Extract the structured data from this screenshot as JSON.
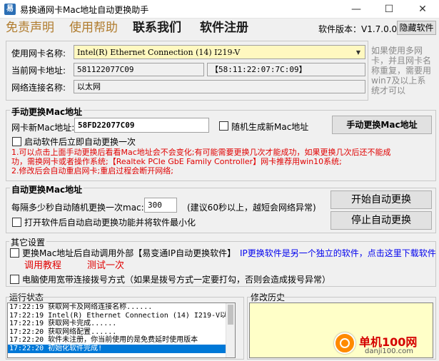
{
  "window": {
    "title": "易换通网卡Mac地址自动更换助手",
    "icon_text": "易",
    "minimize_glyph": "—",
    "maximize_glyph": "☐",
    "close_glyph": "✕"
  },
  "menu": {
    "disclaimer": "免责声明",
    "help": "使用帮助",
    "contact": "联系我们",
    "register": "软件注册",
    "version": "软件版本：V1.7.0.0",
    "hide_button": "隐藏软件"
  },
  "adapter": {
    "nic_label": "使用网卡名称:",
    "nic_value": "Intel(R) Ethernet Connection (14) I219-V",
    "current_mac_label": "当前网卡地址:",
    "current_mac_value": "581122077C09",
    "current_mac_formatted": "【58:11:22:07:7C:09】",
    "conn_label": "网络连接名称:",
    "conn_value": "以太网",
    "hint_lines": [
      "如果使用多网",
      "卡，并且网卡名",
      "称重复，需要用",
      "win7及以上系",
      "统才可以"
    ]
  },
  "manual": {
    "title": "手动更换Mac地址",
    "new_mac_label": "网卡新Mac地址:",
    "new_mac_value": "58FD22077C09",
    "random_label": "随机生成新Mac地址",
    "change_button": "手动更换Mac地址",
    "auto_once_label": "启动软件后立即自动更换一次",
    "notes": [
      "1.可以点击上面手动更换后看看Mac地址会不会变化;有可能需要更换几次才能成功，如果更换几次后还不能成",
      "功，需换网卡或者操作系统;【Realtek PCIe GbE Family Controller】网卡推荐用win10系统;",
      "2.修改后会自动重启网卡;重启过程会断开网络;"
    ]
  },
  "auto": {
    "title": "自动更换Mac地址",
    "interval_label": "每隔多少秒自动随机更换一次mac:",
    "interval_value": "300",
    "interval_hint": "(建议60秒以上，越短会网络异常)",
    "minimize_label": "打开软件后自动启动更换功能并将软件最小化",
    "start_button": "开始自动更换",
    "stop_button": "停止自动更换"
  },
  "other": {
    "title": "其它设置",
    "call_external_label": "更换Mac地址后自动调用外部【易变通IP自动更换软件】",
    "ip_link": "IP更换软件是另一个独立的软件，点击这里下载软件",
    "tutorial_link": "调用教程",
    "test_link": "测试一次",
    "dialup_label": "电脑使用宽带连接拨号方式（如果是拨号方式一定要打勾，否则会造成拨号异常）"
  },
  "status": {
    "title": "运行状态",
    "log": [
      "17:22:19 获取网卡及网络连接名称......",
      "17:22:19 Intel(R) Ethernet Connection (14) I219-V以",
      "17:22:19 获取网卡完成......",
      "17:22:20 获取网络配置......",
      "17:22:20 软件未注册，你当前使用的是免费延时使用版本",
      "17:22:20 初始化软件完成!"
    ]
  },
  "history": {
    "title": "修改历史"
  },
  "watermark": {
    "site": "单机100网",
    "url": "danji100.com"
  }
}
